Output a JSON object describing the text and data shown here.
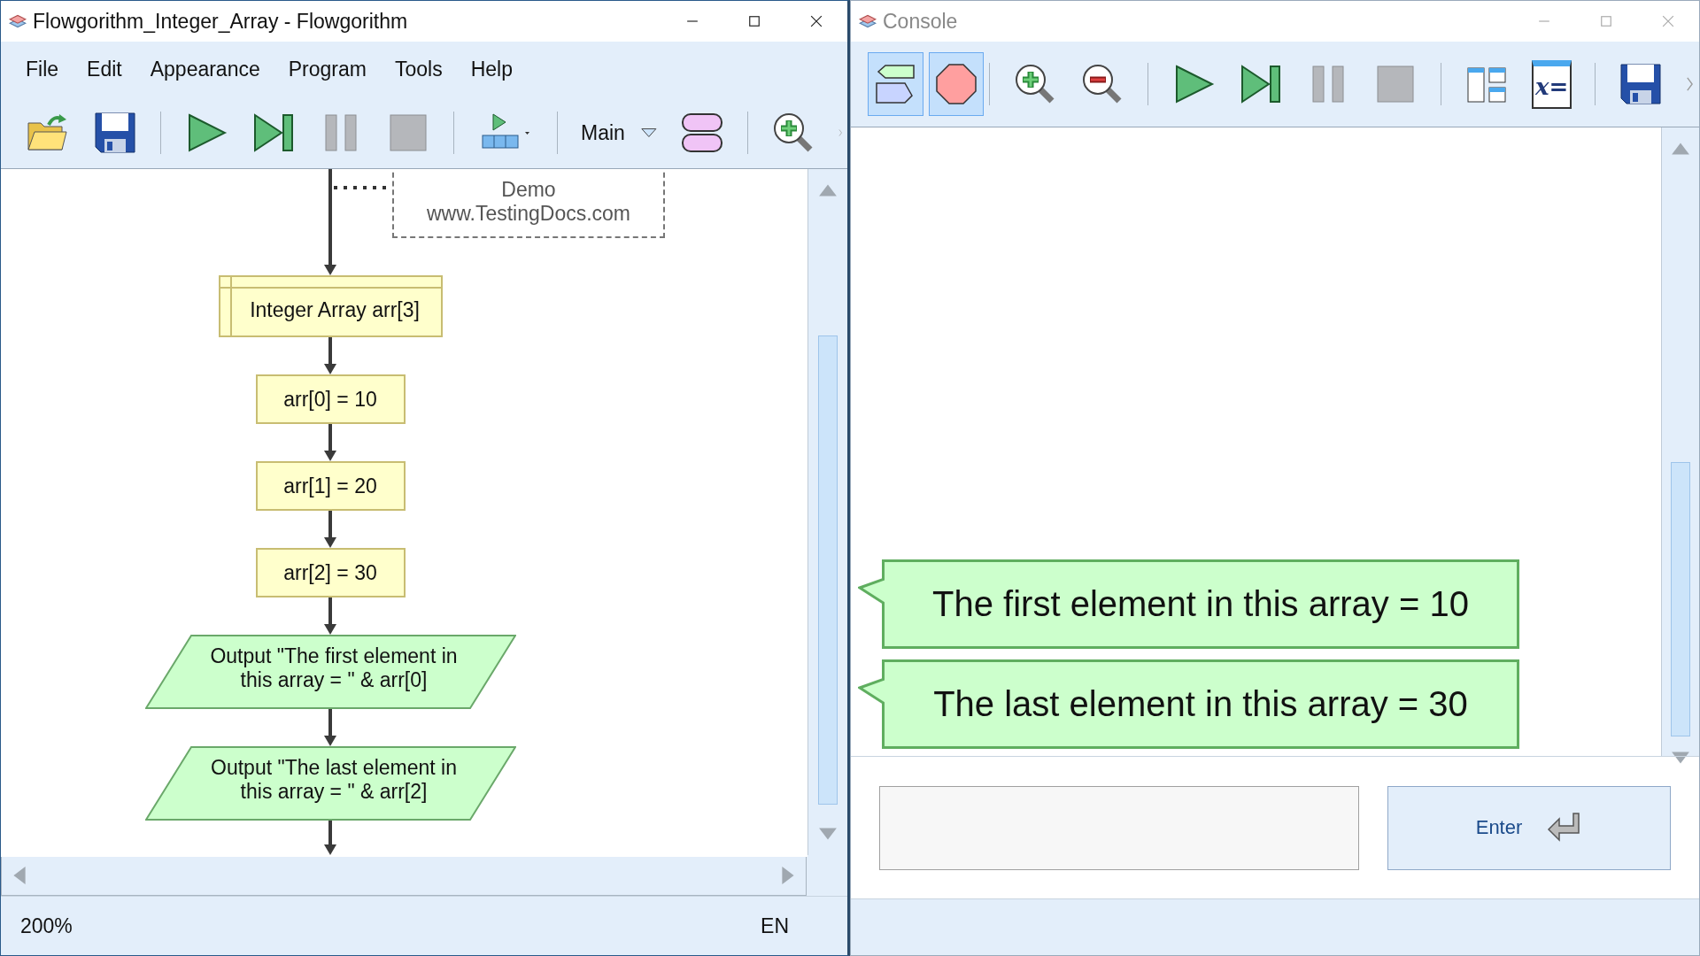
{
  "editor_window": {
    "title": "Flowgorithm_Integer_Array - Flowgorithm",
    "menu": [
      "File",
      "Edit",
      "Appearance",
      "Program",
      "Tools",
      "Help"
    ],
    "function_selector": "Main",
    "comment": {
      "lines": [
        "Demo",
        "www.TestingDocs.com"
      ]
    },
    "flowchart": [
      {
        "kind": "declare",
        "text": "Integer Array arr[3]"
      },
      {
        "kind": "assign",
        "text": "arr[0] = 10"
      },
      {
        "kind": "assign",
        "text": "arr[1] = 20"
      },
      {
        "kind": "assign",
        "text": "arr[2] = 30"
      },
      {
        "kind": "output",
        "text": "Output \"The first element in this array = \" & arr[0]"
      },
      {
        "kind": "output",
        "text": "Output \"The last element in this array = \" & arr[2]"
      }
    ],
    "status_bar": {
      "zoom": "200%",
      "language": "EN"
    }
  },
  "console_window": {
    "title": "Console",
    "toggles": [
      {
        "kind": "comments",
        "on": true
      },
      {
        "kind": "stop",
        "on": true
      }
    ],
    "variables_icon_text": "x=",
    "messages": [
      "The first element in this array = 10",
      "The last element in this array = 30"
    ],
    "enter_button": "Enter"
  }
}
